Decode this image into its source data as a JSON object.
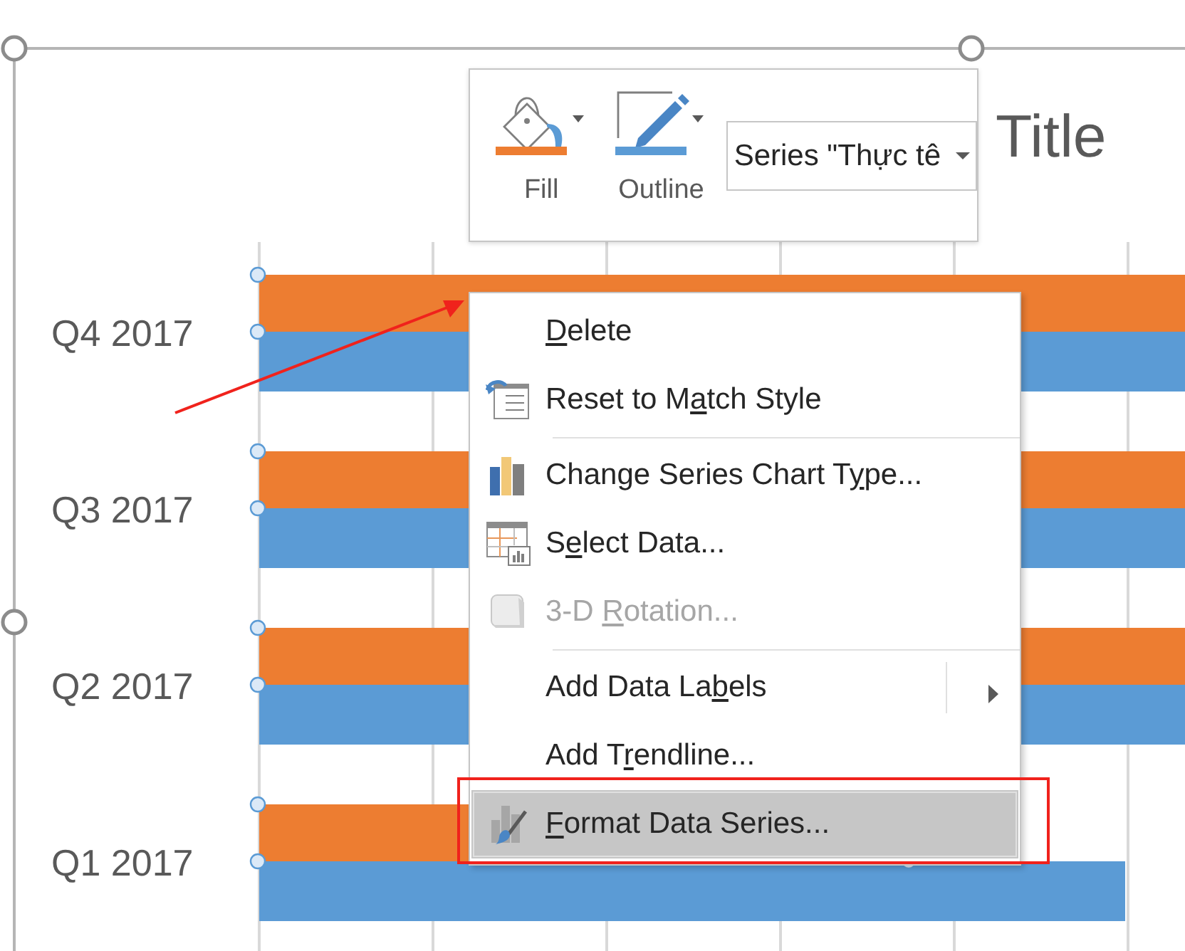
{
  "chart": {
    "title": "Title",
    "categories": [
      "Q4 2017",
      "Q3 2017",
      "Q2 2017",
      "Q1 2017"
    ]
  },
  "mini_toolbar": {
    "buttons": [
      {
        "kind": "fill",
        "label": "Fill"
      },
      {
        "kind": "outline",
        "label": "Outline"
      }
    ],
    "selector": {
      "value": "Series \"Thực tê"
    }
  },
  "context_menu": {
    "items": [
      {
        "kind": "item",
        "key": "D",
        "post": "elete",
        "disabled": false,
        "selected": false,
        "submenu": false
      },
      {
        "kind": "item",
        "pre": "Reset to M",
        "key": "a",
        "post": "tch Style",
        "disabled": false,
        "selected": false,
        "submenu": false
      },
      {
        "kind": "separator"
      },
      {
        "kind": "item",
        "pre": "Change Series Chart T",
        "key": "y",
        "post": "pe...",
        "disabled": false,
        "selected": false,
        "submenu": false
      },
      {
        "kind": "item",
        "pre": "S",
        "key": "e",
        "post": "lect Data...",
        "disabled": false,
        "selected": false,
        "submenu": false
      },
      {
        "kind": "item",
        "pre": "3-D ",
        "key": "R",
        "post": "otation...",
        "disabled": true,
        "selected": false,
        "submenu": false
      },
      {
        "kind": "separator"
      },
      {
        "kind": "item",
        "pre": "Add Data La",
        "key": "b",
        "post": "els",
        "disabled": false,
        "selected": false,
        "submenu": true
      },
      {
        "kind": "item",
        "pre": "Add T",
        "key": "r",
        "post": "endline...",
        "disabled": false,
        "selected": false,
        "submenu": false
      },
      {
        "kind": "item",
        "key": "F",
        "post": "ormat Data Series...",
        "disabled": false,
        "selected": true,
        "submenu": false
      }
    ]
  }
}
